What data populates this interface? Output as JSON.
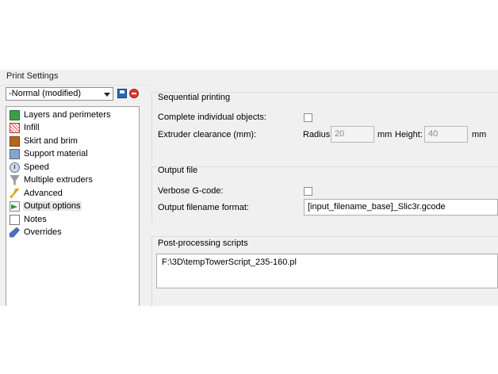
{
  "window": {
    "title": "Print Settings"
  },
  "preset": {
    "value": "-Normal (modified)"
  },
  "icons": {
    "save": "save-icon",
    "delete": "delete-icon"
  },
  "tree": {
    "items": [
      {
        "label": "Layers and perimeters",
        "icon": "layers-icon"
      },
      {
        "label": "Infill",
        "icon": "infill-icon"
      },
      {
        "label": "Skirt and brim",
        "icon": "skirt-icon"
      },
      {
        "label": "Support material",
        "icon": "support-icon"
      },
      {
        "label": "Speed",
        "icon": "speed-icon"
      },
      {
        "label": "Multiple extruders",
        "icon": "funnel-icon"
      },
      {
        "label": "Advanced",
        "icon": "wand-icon"
      },
      {
        "label": "Output options",
        "icon": "output-icon",
        "selected": true
      },
      {
        "label": "Notes",
        "icon": "notes-icon"
      },
      {
        "label": "Overrides",
        "icon": "wrench-icon"
      }
    ]
  },
  "sequential": {
    "title": "Sequential printing",
    "complete_label": "Complete individual objects:",
    "complete_checked": false,
    "clearance_label": "Extruder clearance (mm):",
    "radius_label": "Radius:",
    "radius_value": "20",
    "radius_unit": "mm",
    "height_label": "Height:",
    "height_value": "40",
    "height_unit": "mm"
  },
  "output_file": {
    "title": "Output file",
    "verbose_label": "Verbose G-code:",
    "verbose_checked": false,
    "format_label": "Output filename format:",
    "format_value": "[input_filename_base]_Slic3r.gcode"
  },
  "post_processing": {
    "title": "Post-processing scripts",
    "value": "F:\\3D\\tempTowerScript_235-160.pl"
  }
}
